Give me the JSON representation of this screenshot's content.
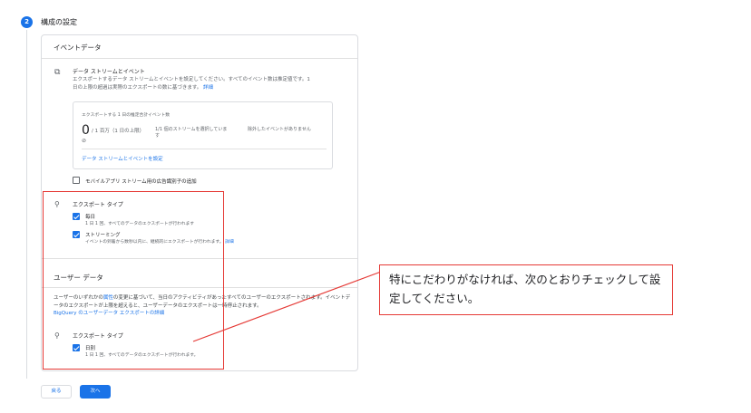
{
  "step": {
    "number": "2",
    "title": "構成の設定"
  },
  "event_data": {
    "heading": "イベントデータ",
    "data_stream": {
      "title": "データ ストリームとイベント",
      "desc": "エクスポートするデータ ストリームとイベントを設定してください。すべてのイベント数は推定値です。1 日の上限の超過は実際のエクスポートの数に基づきます。",
      "link": "詳細"
    },
    "limit": {
      "label": "エクスポートする 1 日の推定合計イベント数",
      "value": "0",
      "unit": "/ 1 百万（1 日の上限）",
      "note": "1/1 個のストリームを選択しています",
      "note2": "除外したイベントがありません",
      "help": "⊘",
      "link": "データ ストリームとイベントを設定"
    },
    "mobile_id": {
      "label": "モバイルアプリ ストリーム用の広告識別子の追加",
      "checked": false
    },
    "export_type": {
      "heading": "エクスポート タイプ",
      "options": [
        {
          "label": "毎日",
          "desc": "1 日 1 回、すべてのデータのエクスポートが行われます",
          "checked": true
        },
        {
          "label": "ストリーミング",
          "desc": "イベントの到着から数秒以内に、継続的にエクスポートが行われます。",
          "link": "詳細",
          "checked": true
        }
      ]
    }
  },
  "user_data": {
    "heading": "ユーザー データ",
    "desc_pre": "ユーザーのいずれかの",
    "desc_link1": "属性",
    "desc_post": "の変更に基づいて、当日のアクティビティがあったすべてのユーザーのエクスポートされます。イベントデータのエクスポートが上限を超えると、ユーザーデータのエクスポートは一時停止されます。",
    "desc_link2": "BigQuery のユーザーデータ エクスポートの詳細",
    "export_type": {
      "heading": "エクスポート タイプ",
      "options": [
        {
          "label": "日別",
          "desc": "1 日 1 回、すべてのデータのエクスポートが行われます。",
          "checked": true
        }
      ]
    }
  },
  "callout": "特にこだわりがなければ、次のとおりチェックして設定してください。",
  "buttons": {
    "back": "戻る",
    "next": "次へ"
  },
  "colors": {
    "accent": "#1a73e8",
    "annotation": "#e53935"
  }
}
